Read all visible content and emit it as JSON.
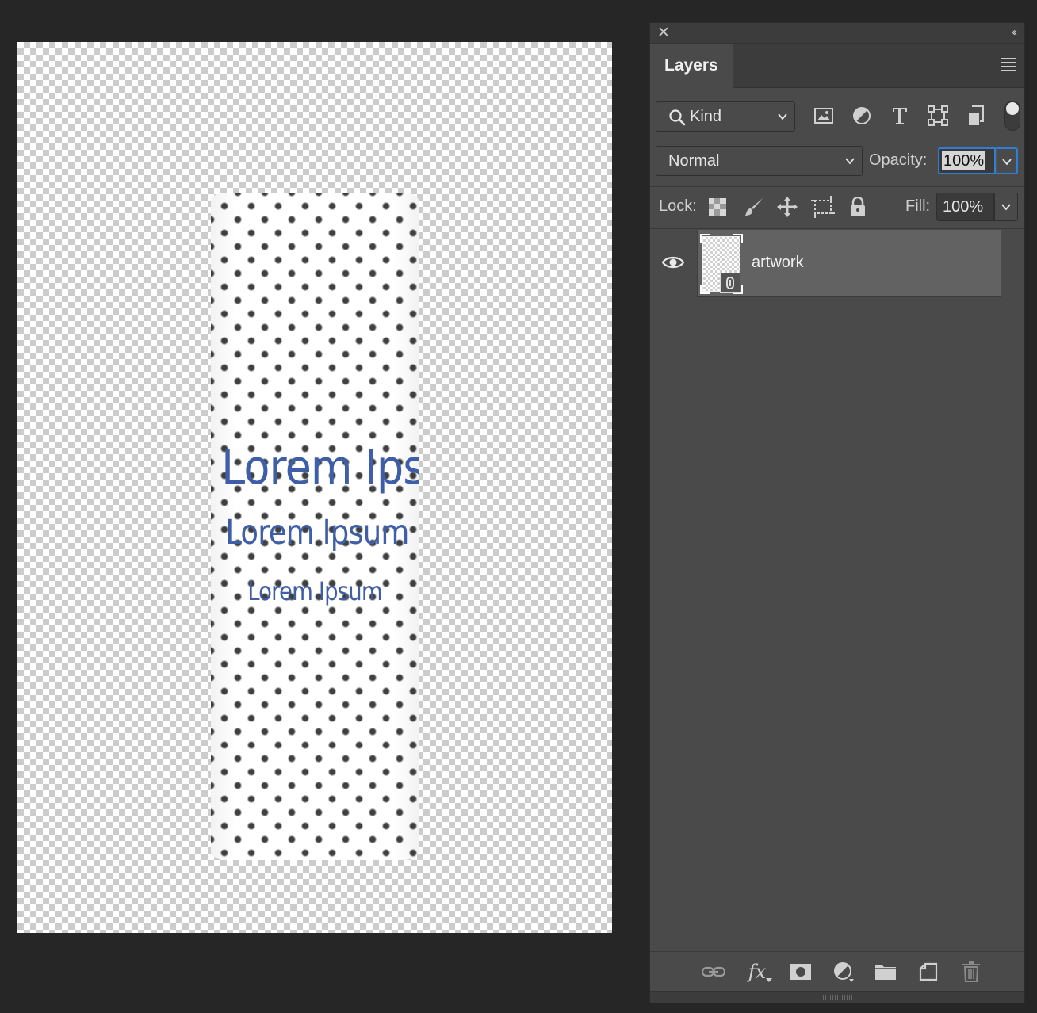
{
  "canvas": {
    "artwork_lines": [
      "Lorem Ipsum",
      "Lorem Ipsum",
      "Lorem Ipsum"
    ],
    "text_color": "#3f5ea8"
  },
  "panel": {
    "close_icon": "close-icon",
    "collapse_icon": "double-chevron-left-icon",
    "tab_label": "Layers",
    "menu_icon": "hamburger-menu-icon",
    "filter": {
      "kind_label": "Kind",
      "icons": [
        "image-filter-icon",
        "adjustment-filter-icon",
        "type-filter-icon",
        "shape-filter-icon",
        "smart-object-filter-icon"
      ]
    },
    "blend_mode": "Normal",
    "opacity_label": "Opacity:",
    "opacity_value": "100%",
    "lock_label": "Lock:",
    "lock_icons": [
      "lock-transparent-pixels-icon",
      "lock-image-pixels-icon",
      "lock-position-icon",
      "lock-artboard-icon",
      "lock-all-icon"
    ],
    "fill_label": "Fill:",
    "fill_value": "100%",
    "layers": [
      {
        "name": "artwork",
        "visible": true,
        "type": "smart-object",
        "selected": true
      }
    ],
    "bottom_icons": [
      "link-layers-icon",
      "fx-icon",
      "add-mask-icon",
      "adjustment-layer-icon",
      "new-group-icon",
      "new-layer-icon",
      "delete-layer-icon"
    ],
    "fx_label": "fx",
    "accent_color": "#2f7fd6"
  }
}
